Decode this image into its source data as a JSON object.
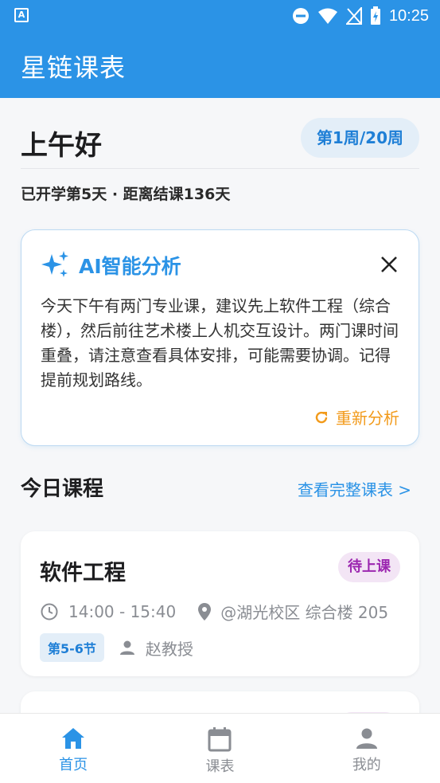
{
  "status_bar": {
    "time": "10:25",
    "left_icon_letter": "A"
  },
  "app": {
    "title": "星链课表"
  },
  "header": {
    "greeting": "上午好",
    "week_badge": "第1周/20周",
    "progress": "已开学第5天 · 距离结课136天"
  },
  "ai_card": {
    "title": "AI智能分析",
    "text": "今天下午有两门专业课，建议先上软件工程（综合楼），然后前往艺术楼上人机交互设计。两门课时间重叠，请注意查看具体安排，可能需要协调。记得提前规划路线。",
    "reanalyze_label": "重新分析"
  },
  "today": {
    "title": "今日课程",
    "view_all": "查看完整课表 >"
  },
  "courses": [
    {
      "name": "软件工程",
      "status": "待上课",
      "time": "14:00 - 15:40",
      "location": "@湖光校区 综合楼 205",
      "period": "第5-6节",
      "teacher": "赵教授"
    }
  ],
  "bottom_nav": [
    {
      "label": "首页",
      "icon": "home-icon",
      "active": true
    },
    {
      "label": "课表",
      "icon": "calendar-icon",
      "active": false
    },
    {
      "label": "我的",
      "icon": "person-icon",
      "active": false
    }
  ],
  "colors": {
    "primary": "#2b93e6",
    "accent_orange": "#f29a1a",
    "status_purple": "#9c27b0"
  }
}
